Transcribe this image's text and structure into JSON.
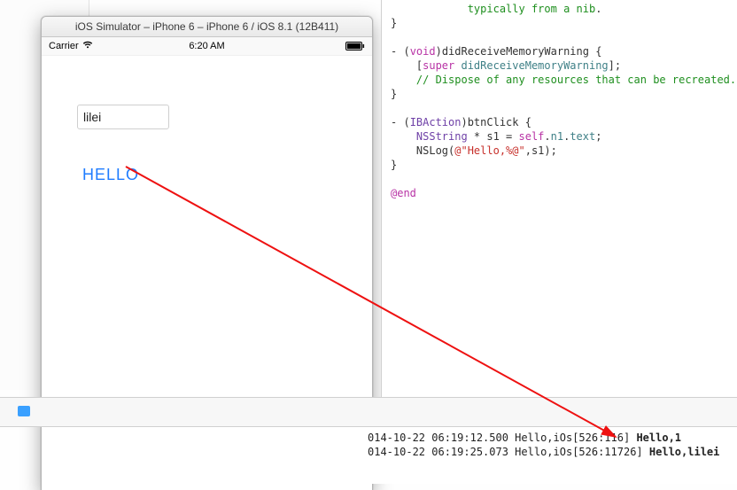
{
  "simulator": {
    "window_title": "iOS Simulator – iPhone 6 – iPhone 6 / iOS 8.1 (12B411)",
    "status_carrier": "Carrier",
    "status_time": "6:20 AM",
    "input_value": "lilei",
    "button_label": "HELLO"
  },
  "code": {
    "l1a": "            typically from a nib",
    "l1b": ".",
    "l2": "}",
    "l4a": "- (",
    "l4b": "void",
    "l4c": ")didReceiveMemoryWarning {",
    "l5a": "    [",
    "l5b": "super",
    "l5c": " didReceiveMemoryWarning",
    "l5d": "];",
    "l6": "    // Dispose of any resources that can be recreated.",
    "l7": "}",
    "l9a": "- (",
    "l9b": "IBAction",
    "l9c": ")btnClick {",
    "l10a": "    ",
    "l10b": "NSString",
    "l10c": " * s1 = ",
    "l10d": "self",
    "l10e": ".",
    "l10f": "n1",
    "l10g": ".",
    "l10h": "text",
    "l10i": ";",
    "l11a": "    NSLog(",
    "l11b": "@",
    "l11c": "\"Hello,%@\"",
    "l11d": ",s1);",
    "l12": "}",
    "l14": "@end"
  },
  "console": {
    "line1_pre": "014-10-22 06:19:12.500 Hello,iOs[526:11",
    "line1_mid": "6",
    "line1_post": "] ",
    "line1_msg": "Hello,1",
    "line2_pre": "014-10-22 06:19:25.073 Hello,iOs[526:11726] ",
    "line2_msg": "Hello,lilei"
  }
}
